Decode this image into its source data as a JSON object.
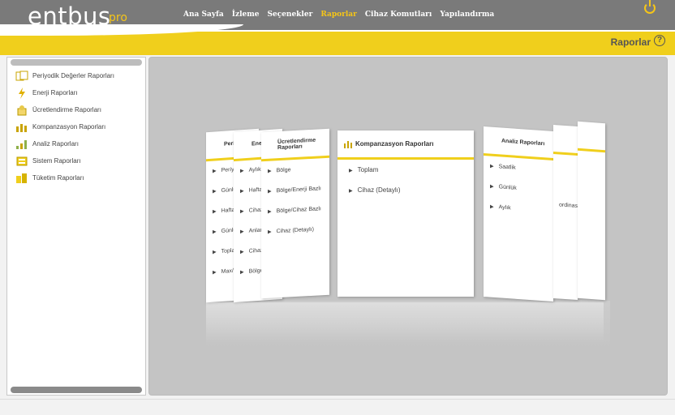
{
  "app": {
    "logo": "entbus",
    "logo_suffix": "pro"
  },
  "nav": [
    {
      "label": "Ana Sayfa",
      "active": false
    },
    {
      "label": "İzleme",
      "active": false
    },
    {
      "label": "Seçenekler",
      "active": false
    },
    {
      "label": "Raporlar",
      "active": true
    },
    {
      "label": "Cihaz Komutları",
      "active": false
    },
    {
      "label": "Yapılandırma",
      "active": false
    }
  ],
  "page": {
    "title": "Raporlar",
    "help": "?"
  },
  "sidebar": {
    "items": [
      {
        "label": "Periyodik Değerler Raporları",
        "icon": "periodic-icon"
      },
      {
        "label": "Enerji Raporları",
        "icon": "energy-icon"
      },
      {
        "label": "Ücretlendirme Raporları",
        "icon": "pricing-icon"
      },
      {
        "label": "Kompanzasyon Raporları",
        "icon": "compensation-icon"
      },
      {
        "label": "Analiz Raporları",
        "icon": "analysis-icon"
      },
      {
        "label": "Sistem Raporları",
        "icon": "system-icon"
      },
      {
        "label": "Tüketim Raporları",
        "icon": "consumption-icon"
      }
    ]
  },
  "cards": {
    "center": {
      "title": "Kompanzasyon Raporları",
      "items": [
        "Toplam",
        "Cihaz (Detaylı)"
      ]
    },
    "left_back": {
      "title": "Periyo",
      "items": [
        "Periyod",
        "Günlük",
        "Haftalı",
        "Günlük",
        "Toplam",
        "Max/Min"
      ]
    },
    "left_mid": {
      "title": "Enerji",
      "items": [
        "Aylık",
        "Haftalı",
        "Cihaz (D",
        "Anlama",
        "Cihaz B",
        "Bölge B"
      ]
    },
    "left_front": {
      "title": "Ücretlendirme Raporları",
      "items": [
        "Bölge",
        "Bölge/Enerji Bazlı",
        "Bölge/Cihaz Bazlı",
        "Cihaz (Detaylı)"
      ]
    },
    "right": {
      "title": "Analiz Raporları",
      "items": [
        "Saatlik",
        "Günlük",
        "Aylık"
      ]
    },
    "right_far_text": "ordinas"
  },
  "colors": {
    "accent": "#f0cf1c",
    "header_bg": "#7a7a7a",
    "main_bg": "#c4c4c4"
  }
}
